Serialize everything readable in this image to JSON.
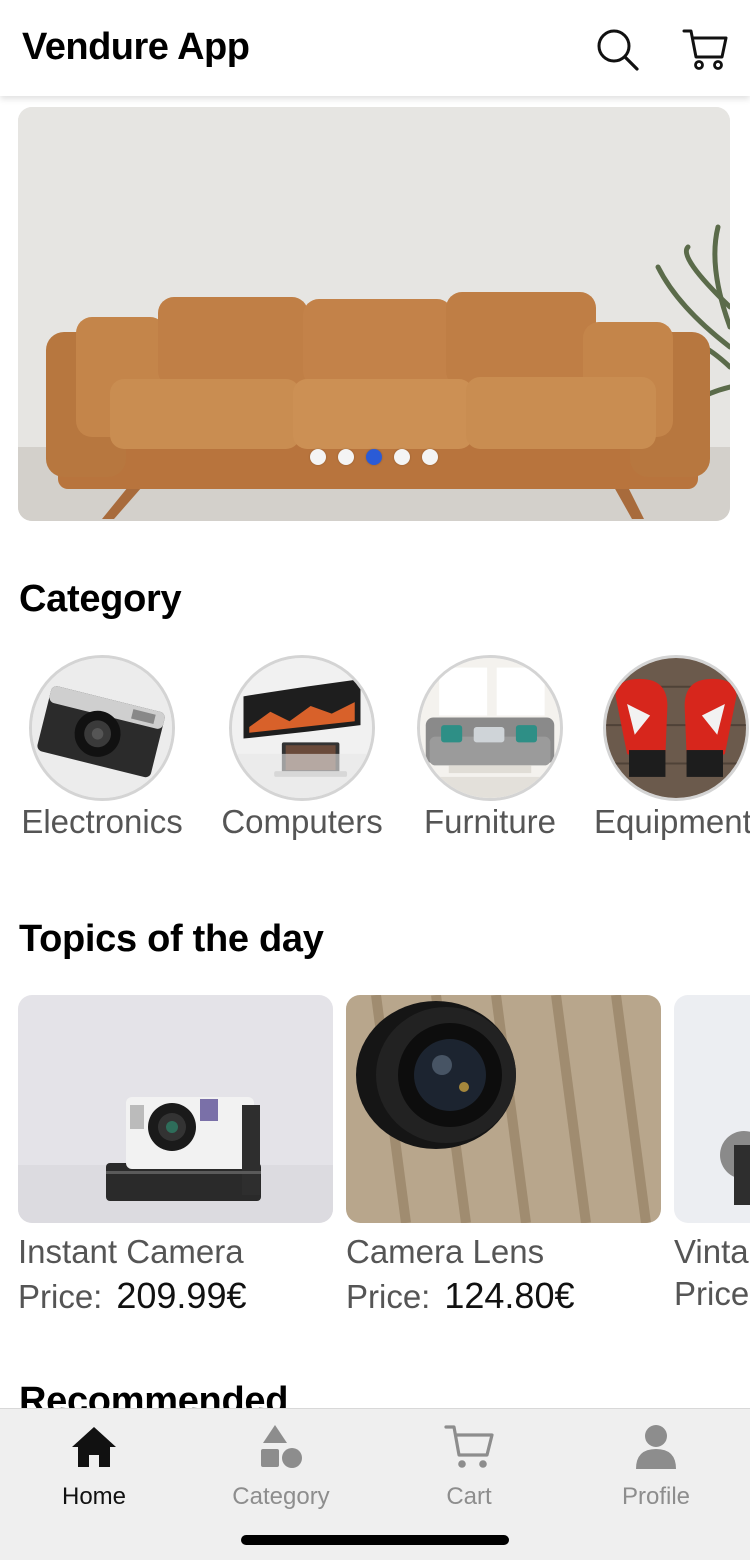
{
  "header": {
    "title": "Vendure App",
    "search_icon": "search-icon",
    "cart_icon": "cart-icon"
  },
  "banner": {
    "image": "leather-sofa",
    "slide_count": 5,
    "active_slide": 3
  },
  "category_section": {
    "title": "Category",
    "items": [
      {
        "label": "Electronics",
        "image": "camera"
      },
      {
        "label": "Computers",
        "image": "monitor-laptop"
      },
      {
        "label": "Furniture",
        "image": "sofa-room"
      },
      {
        "label": "Equipment",
        "image": "boxing-gloves"
      }
    ]
  },
  "topics_section": {
    "title": "Topics of the day",
    "price_label": "Price:",
    "items": [
      {
        "name": "Instant Camera",
        "price": "209.99€",
        "image": "instant-camera"
      },
      {
        "name": "Camera Lens",
        "price": "124.80€",
        "image": "camera-lens"
      },
      {
        "name": "Vintage",
        "price": "",
        "image": "vintage"
      }
    ]
  },
  "recommended_section": {
    "title": "Recommended"
  },
  "bottom_nav": {
    "items": [
      {
        "label": "Home",
        "icon": "home-icon",
        "active": true
      },
      {
        "label": "Category",
        "icon": "category-icon",
        "active": false
      },
      {
        "label": "Cart",
        "icon": "cart-icon",
        "active": false
      },
      {
        "label": "Profile",
        "icon": "profile-icon",
        "active": false
      }
    ]
  },
  "colors": {
    "accent": "#2a5bd7",
    "nav_background": "#efefef",
    "muted_text": "#555555"
  }
}
